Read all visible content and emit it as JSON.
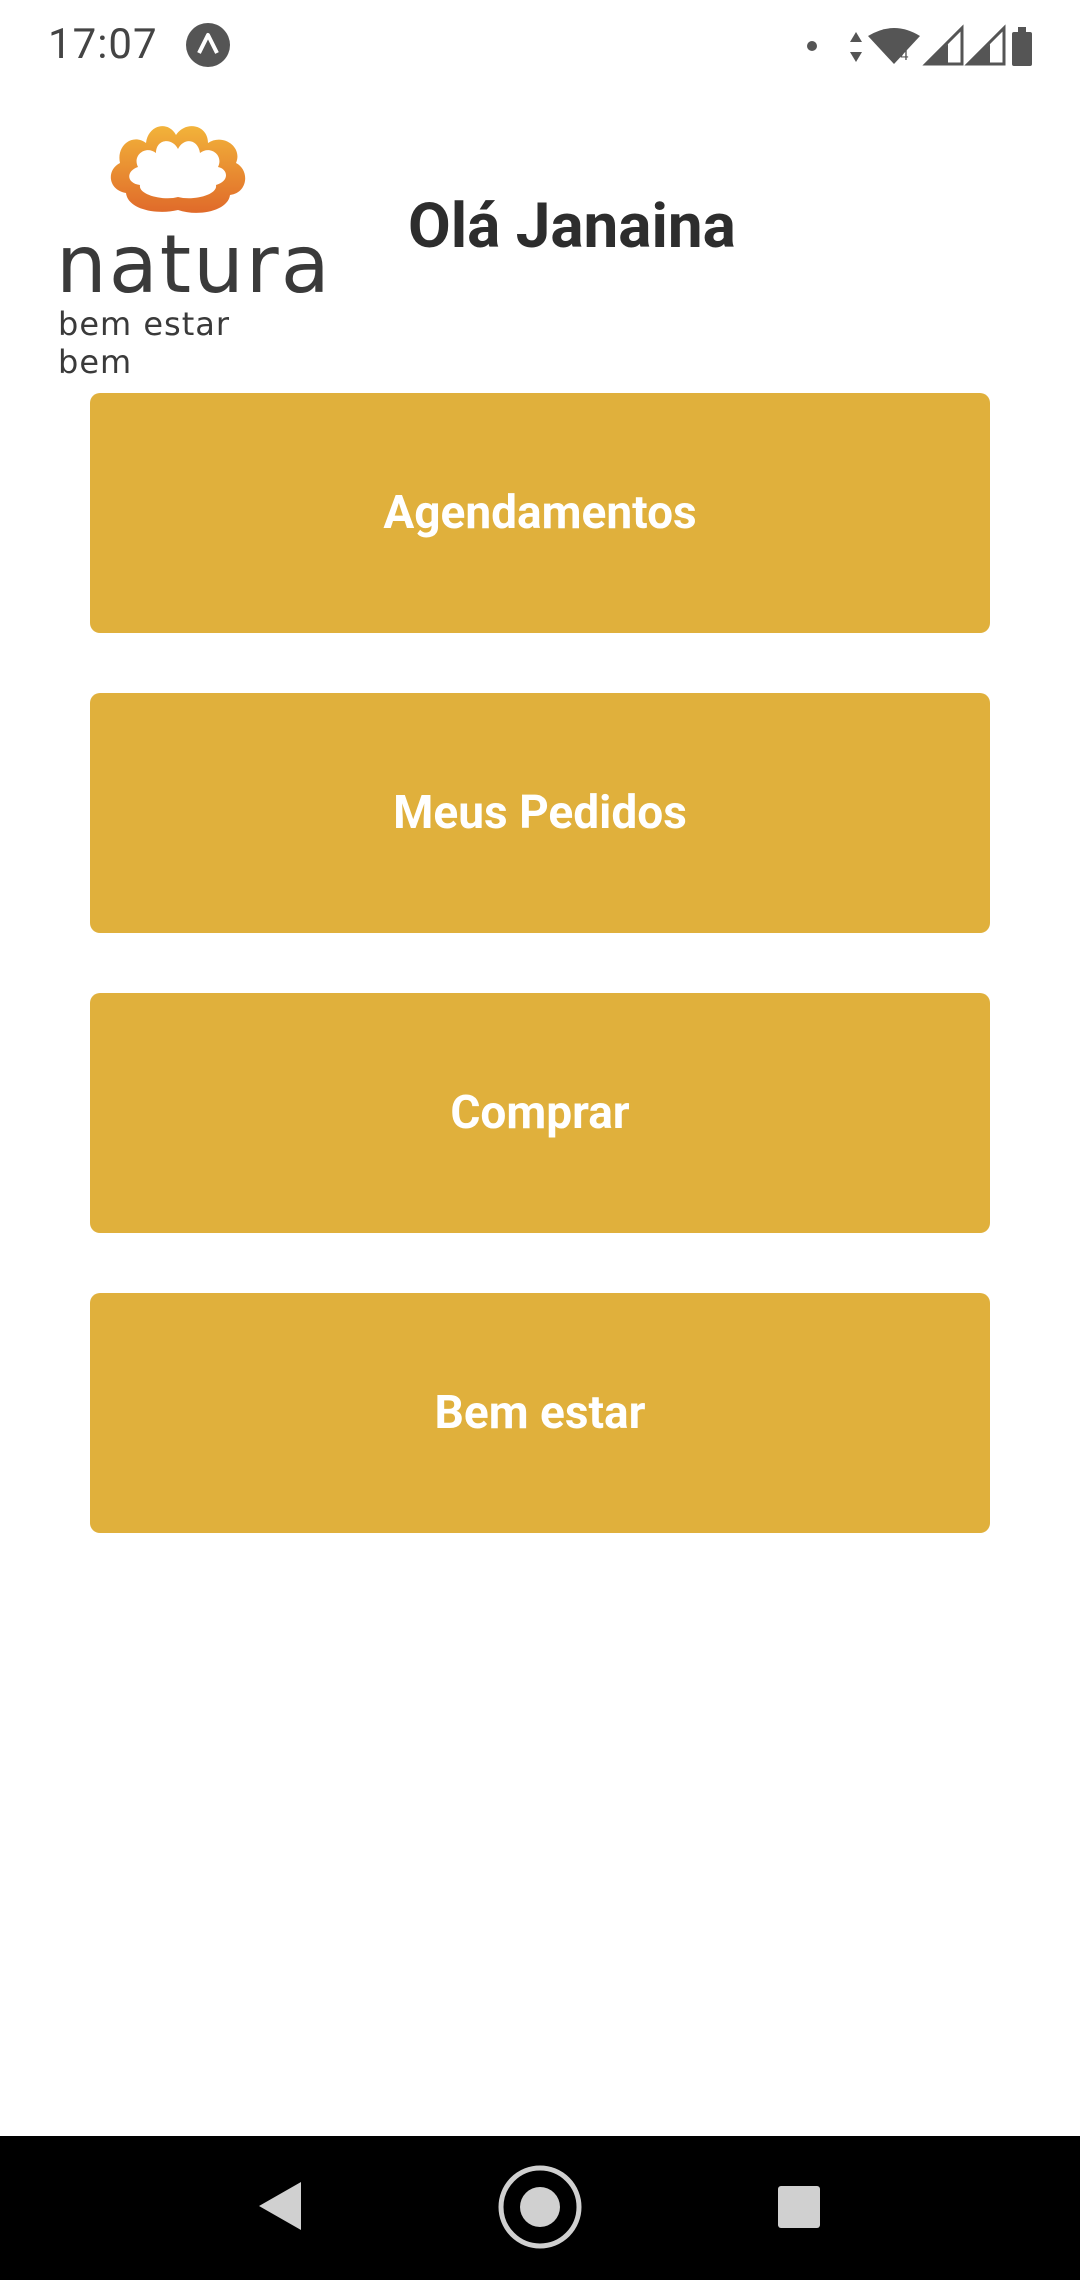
{
  "status_bar": {
    "time": "17:07",
    "icons": [
      "app-notification-icon",
      "dot-icon",
      "data-arrows-icon",
      "wifi-icon",
      "signal-icon",
      "signal-icon",
      "battery-icon"
    ]
  },
  "header": {
    "logo": {
      "wordmark": "natura",
      "tagline": "bem estar bem"
    },
    "greeting": "Olá Janaina"
  },
  "menu": {
    "items": [
      {
        "label": "Agendamentos"
      },
      {
        "label": "Meus Pedidos"
      },
      {
        "label": "Comprar"
      },
      {
        "label": "Bem estar"
      }
    ]
  },
  "colors": {
    "accent": "#e0b03c",
    "greeting_text": "#2d2d2d",
    "logo_orange": "#e88a2a"
  },
  "nav_bar": {
    "icons": [
      "back-icon",
      "home-icon",
      "recents-icon"
    ]
  }
}
